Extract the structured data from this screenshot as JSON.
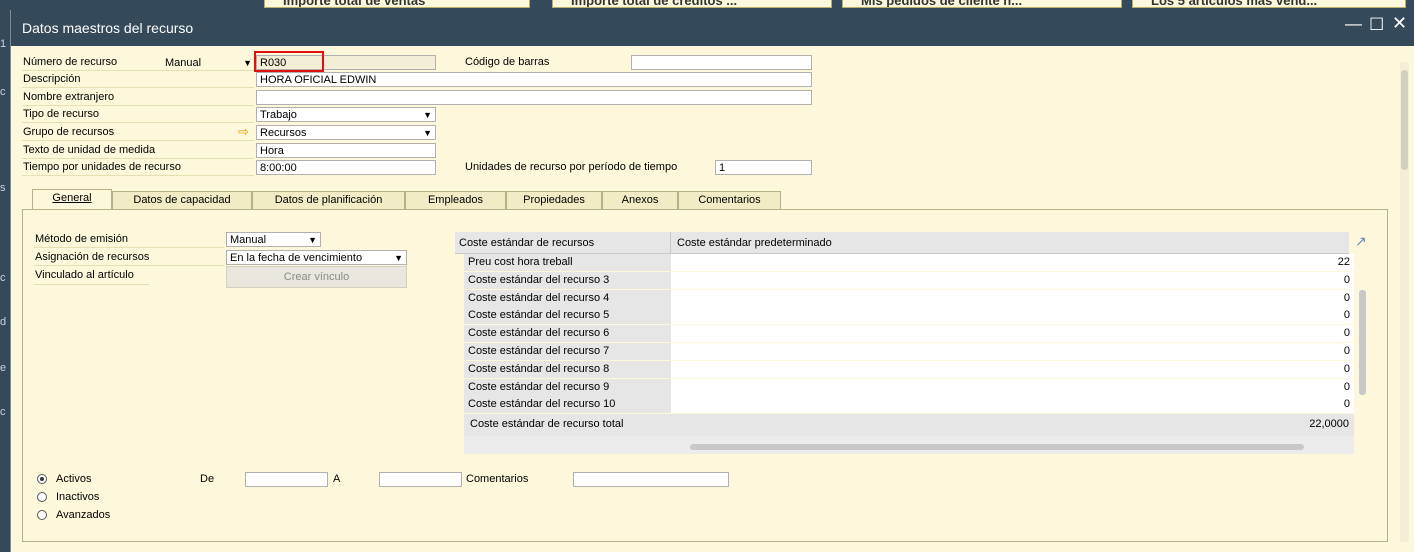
{
  "bg_tabs": [
    "Importe total de ventas",
    "Importe total de créditos ...",
    "Mis pedidos de cliente n...",
    "Los 5 artículos más vend..."
  ],
  "window": {
    "title": "Datos maestros del recurso",
    "min_icon": "minimize-icon",
    "max_icon": "maximize-icon",
    "close_icon": "close-icon"
  },
  "header": {
    "numero_label": "Número de recurso",
    "numero_series": "Manual",
    "numero_value": "R030",
    "codigo_barras_label": "Código de barras",
    "codigo_barras_value": "",
    "descripcion_label": "Descripción",
    "descripcion_value": "HORA OFICIAL EDWIN",
    "nombre_extranjero_label": "Nombre extranjero",
    "nombre_extranjero_value": "",
    "tipo_label": "Tipo de recurso",
    "tipo_value": "Trabajo",
    "grupo_label": "Grupo de recursos",
    "grupo_value": "Recursos",
    "texto_unidad_label": "Texto de unidad de medida",
    "texto_unidad_value": "Hora",
    "tiempo_label": "Tiempo por unidades de recurso",
    "tiempo_value": "8:00:00",
    "unidades_periodo_label": "Unidades de recurso por período de tiempo",
    "unidades_periodo_value": "1"
  },
  "tabs": [
    "General",
    "Datos de capacidad",
    "Datos de planificación",
    "Empleados",
    "Propiedades",
    "Anexos",
    "Comentarios"
  ],
  "general": {
    "metodo_label": "Método de emisión",
    "metodo_value": "Manual",
    "asignacion_label": "Asignación de recursos",
    "asignacion_value": "En la fecha de vencimiento",
    "vinculado_label": "Vinculado al artículo",
    "crear_vinculo": "Crear vínculo"
  },
  "cost_table": {
    "col1": "Coste estándar de recursos",
    "col2": "Coste estándar predeterminado",
    "rows": [
      {
        "label": "Preu cost hora treball",
        "value": "22"
      },
      {
        "label": "Coste estándar del recurso 3",
        "value": "0"
      },
      {
        "label": "Coste estándar del recurso 4",
        "value": "0"
      },
      {
        "label": "Coste estándar del recurso 5",
        "value": "0"
      },
      {
        "label": "Coste estándar del recurso 6",
        "value": "0"
      },
      {
        "label": "Coste estándar del recurso 7",
        "value": "0"
      },
      {
        "label": "Coste estándar del recurso 8",
        "value": "0"
      },
      {
        "label": "Coste estándar del recurso 9",
        "value": "0"
      },
      {
        "label": "Coste estándar del recurso 10",
        "value": "0"
      }
    ],
    "total_label": "Coste estándar de recurso total",
    "total_value": "22,0000"
  },
  "status": {
    "activos": "Activos",
    "inactivos": "Inactivos",
    "avanzados": "Avanzados",
    "selected": "activos",
    "de_label": "De",
    "de_value": "",
    "a_label": "A",
    "a_value": "",
    "comentarios_label": "Comentarios",
    "comentarios_value": ""
  },
  "left_strip_chars": [
    "1",
    "c",
    "s",
    "c",
    "d",
    "e",
    "c"
  ]
}
